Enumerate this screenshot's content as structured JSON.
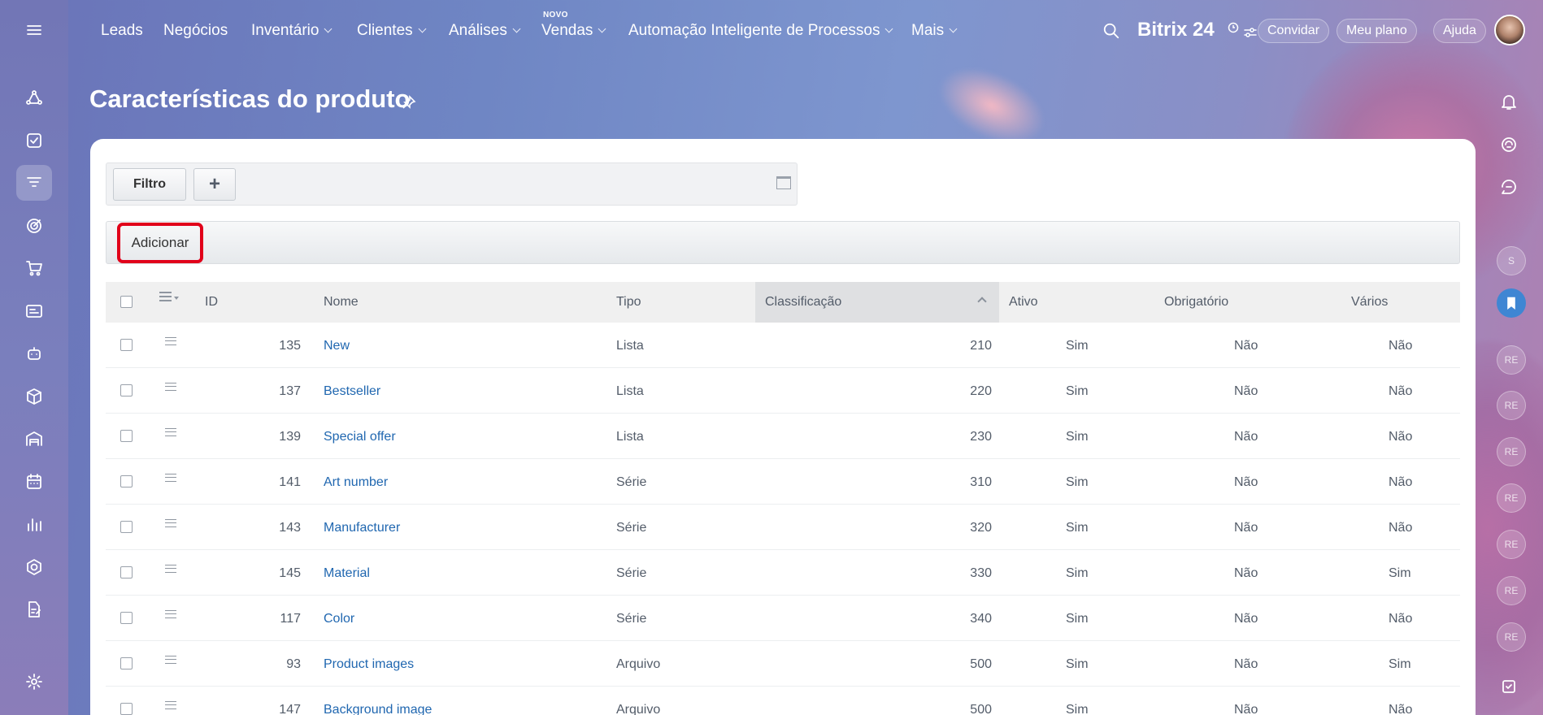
{
  "topnav": {
    "items": [
      {
        "label": "Leads",
        "dropdown": false
      },
      {
        "label": "Negócios",
        "dropdown": false
      },
      {
        "label": "Inventário",
        "dropdown": true
      },
      {
        "label": "Clientes",
        "dropdown": true
      },
      {
        "label": "Análises",
        "dropdown": true
      },
      {
        "label": "Vendas",
        "dropdown": true,
        "badge": "NOVO"
      },
      {
        "label": "Automação Inteligente de Processos",
        "dropdown": true
      },
      {
        "label": "Mais",
        "dropdown": true
      }
    ],
    "brand": "Bitrix 24",
    "invite_label": "Convidar",
    "plan_label": "Meu plano",
    "help_label": "Ajuda"
  },
  "page": {
    "title": "Características do produto"
  },
  "filter": {
    "filter_label": "Filtro",
    "plus_label": "+"
  },
  "toolbar": {
    "add_label": "Adicionar"
  },
  "right_rail": {
    "avatars": [
      "S",
      "RE",
      "RE",
      "RE",
      "RE",
      "RE",
      "RE",
      "RE"
    ]
  },
  "grid": {
    "columns": {
      "id": "ID",
      "name": "Nome",
      "type": "Tipo",
      "sort": "Classificação",
      "active": "Ativo",
      "required": "Obrigatório",
      "multiple": "Vários"
    },
    "rows": [
      {
        "id": "135",
        "name": "New",
        "type": "Lista",
        "sort": "210",
        "active": "Sim",
        "required": "Não",
        "multiple": "Não"
      },
      {
        "id": "137",
        "name": "Bestseller",
        "type": "Lista",
        "sort": "220",
        "active": "Sim",
        "required": "Não",
        "multiple": "Não"
      },
      {
        "id": "139",
        "name": "Special offer",
        "type": "Lista",
        "sort": "230",
        "active": "Sim",
        "required": "Não",
        "multiple": "Não"
      },
      {
        "id": "141",
        "name": "Art number",
        "type": "Série",
        "sort": "310",
        "active": "Sim",
        "required": "Não",
        "multiple": "Não"
      },
      {
        "id": "143",
        "name": "Manufacturer",
        "type": "Série",
        "sort": "320",
        "active": "Sim",
        "required": "Não",
        "multiple": "Não"
      },
      {
        "id": "145",
        "name": "Material",
        "type": "Série",
        "sort": "330",
        "active": "Sim",
        "required": "Não",
        "multiple": "Sim"
      },
      {
        "id": "117",
        "name": "Color",
        "type": "Série",
        "sort": "340",
        "active": "Sim",
        "required": "Não",
        "multiple": "Não"
      },
      {
        "id": "93",
        "name": "Product images",
        "type": "Arquivo",
        "sort": "500",
        "active": "Sim",
        "required": "Não",
        "multiple": "Sim"
      },
      {
        "id": "147",
        "name": "Background image",
        "type": "Arquivo",
        "sort": "500",
        "active": "Sim",
        "required": "Não",
        "multiple": "Não"
      }
    ]
  },
  "colors": {
    "link": "#2067b0",
    "highlight_border": "#e1001a",
    "rail_bookmark": "#3f86d3"
  },
  "icons": {
    "left_rail": [
      "menu-icon",
      "crm-icon",
      "tasks-icon",
      "funnel-icon",
      "target-icon",
      "cart-icon",
      "invoice-icon",
      "robot-icon",
      "box-icon",
      "warehouse-icon",
      "calendar-icon",
      "analytics-icon",
      "hexagon-icon",
      "document-sign-icon",
      "settings-icon"
    ],
    "right_rail": [
      "bell-icon",
      "copilot-icon",
      "chat-icon",
      "bookmark-icon",
      "checklist-icon"
    ]
  }
}
